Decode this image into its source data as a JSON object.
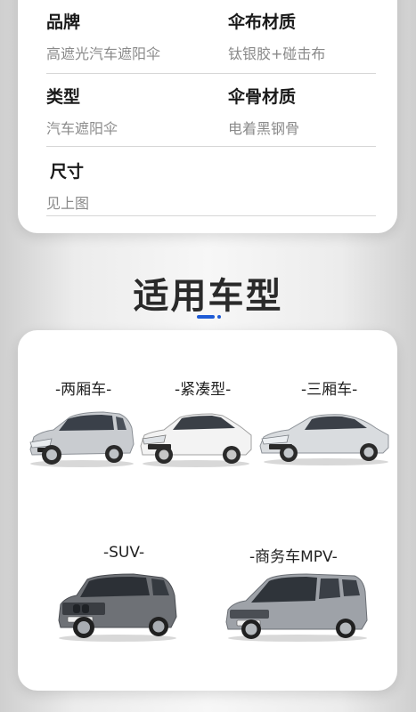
{
  "specs": [
    {
      "label": "品牌",
      "value": "高遮光汽车遮阳伞"
    },
    {
      "label": "伞布材质",
      "value": "钛银胶+碰击布"
    },
    {
      "label": "类型",
      "value": "汽车遮阳伞"
    },
    {
      "label": "伞骨材质",
      "value": "电着黑钢骨"
    },
    {
      "label": "尺寸",
      "value": "见上图"
    }
  ],
  "section_title": "适用车型",
  "accent_color": "#1e5bd6",
  "car_types": [
    {
      "label": "-两厢车-",
      "icon": "hatchback-car-image"
    },
    {
      "label": "-紧凑型-",
      "icon": "compact-sedan-image"
    },
    {
      "label": "-三厢车-",
      "icon": "coupe-sedan-image"
    },
    {
      "label": "-SUV-",
      "icon": "suv-image"
    },
    {
      "label": "-商务车MPV-",
      "icon": "mpv-van-image"
    }
  ]
}
